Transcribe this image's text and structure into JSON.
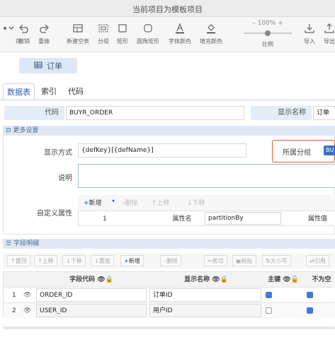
{
  "window": {
    "title": "当前项目为模板项目"
  },
  "toolbar": {
    "save": "存",
    "undo": "撤销",
    "redo": "重做",
    "new_table": "新建空表",
    "group": "分组",
    "rect": "矩形",
    "round_rect": "圆角矩形",
    "font_color": "字体颜色",
    "fill_color": "填充颜色",
    "zoom_value": "100%",
    "zoom_label": "比例",
    "import": "导入",
    "export": "导出"
  },
  "entity_tab": {
    "label": "订单"
  },
  "tabs": [
    "数据表",
    "索引",
    "代码"
  ],
  "table": {
    "code_label": "代码",
    "code_value": "BUYR_ORDER",
    "display_label": "显示名称",
    "display_value": "订单"
  },
  "more_settings": {
    "header": "更多设置",
    "display_mode_label": "显示方式",
    "display_mode_value": "{defKey}[{defName}]",
    "group_label": "所属分组",
    "group_value": "BU",
    "comment_label": "说明",
    "custom_attr_label": "自定义属性",
    "attr_toolbar": {
      "add": "新增",
      "delete": "删除",
      "up": "上移",
      "down": "下移"
    },
    "attr_table": {
      "col_name": "属性名",
      "col_value": "属性值",
      "rows": [
        {
          "index": "1",
          "name": "partitionBy"
        }
      ]
    }
  },
  "fields": {
    "header": "字段明细",
    "toolbar": [
      "置顶",
      "上移",
      "下移",
      "置底",
      "新增",
      "删除",
      "剪切",
      "粘贴",
      "大小写",
      "引用"
    ],
    "columns": [
      "字段代码",
      "显示名称",
      "主键",
      "不为空"
    ],
    "rows": [
      {
        "index": "1",
        "code": "ORDER_ID",
        "name": "订单ID",
        "pk": true,
        "not_null": true
      },
      {
        "index": "2",
        "code": "USER_ID",
        "name": "用户ID",
        "pk": false,
        "not_null": true
      }
    ]
  }
}
